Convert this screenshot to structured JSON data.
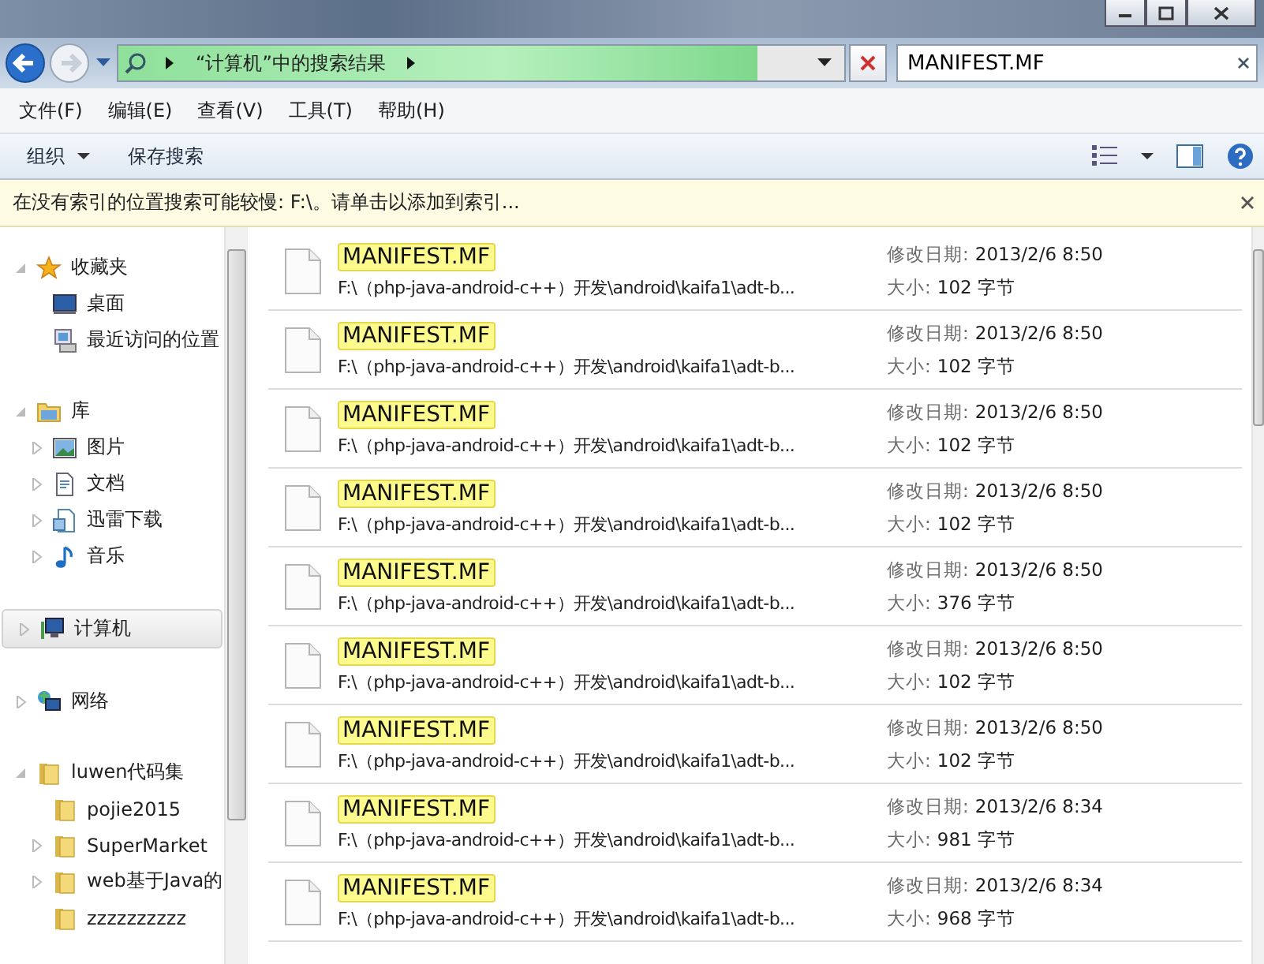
{
  "address": {
    "crumbs": [
      "“计算机”中的搜索结果"
    ]
  },
  "search": {
    "value": "MANIFEST.MF"
  },
  "menu": [
    "文件(F)",
    "编辑(E)",
    "查看(V)",
    "工具(T)",
    "帮助(H)"
  ],
  "toolbar": {
    "organize": "组织",
    "save": "保存搜索"
  },
  "info_bar": "在没有索引的位置搜索可能较慢: F:\\。请单击以添加到索引...",
  "sidebar": [
    {
      "label": "收藏夹",
      "kind": "star",
      "expanded": true,
      "selected": false,
      "children": [
        {
          "label": "桌面",
          "kind": "desktop"
        },
        {
          "label": "最近访问的位置",
          "kind": "recent"
        }
      ]
    },
    {
      "label": "库",
      "kind": "library",
      "expanded": true,
      "selected": false,
      "children": [
        {
          "label": "图片",
          "kind": "pictures",
          "expandable": true
        },
        {
          "label": "文档",
          "kind": "document",
          "expandable": true
        },
        {
          "label": "迅雷下载",
          "kind": "download",
          "expandable": true
        },
        {
          "label": "音乐",
          "kind": "music",
          "expandable": true
        }
      ]
    },
    {
      "label": "计算机",
      "kind": "computer",
      "expanded": false,
      "selected": true
    },
    {
      "label": "网络",
      "kind": "network",
      "expanded": false,
      "selected": false
    },
    {
      "label": "luwen代码集",
      "kind": "folder",
      "expanded": true,
      "selected": false,
      "children": [
        {
          "label": "pojie2015",
          "kind": "folder",
          "expandable": false
        },
        {
          "label": "SuperMarket",
          "kind": "folder",
          "expandable": true
        },
        {
          "label": "web基于Java的",
          "kind": "folder",
          "expandable": true
        },
        {
          "label": "zzzzzzzzzz",
          "kind": "folder",
          "expandable": false
        }
      ]
    }
  ],
  "results": [
    {
      "name": "MANIFEST.MF",
      "path": "F:\\（php-java-android-c++）开发\\android\\kaifa1\\adt-b...",
      "date_label": "修改日期:",
      "date": "2013/2/6 8:50",
      "size_label": "大小:",
      "size": "102 字节"
    },
    {
      "name": "MANIFEST.MF",
      "path": "F:\\（php-java-android-c++）开发\\android\\kaifa1\\adt-b...",
      "date_label": "修改日期:",
      "date": "2013/2/6 8:50",
      "size_label": "大小:",
      "size": "102 字节"
    },
    {
      "name": "MANIFEST.MF",
      "path": "F:\\（php-java-android-c++）开发\\android\\kaifa1\\adt-b...",
      "date_label": "修改日期:",
      "date": "2013/2/6 8:50",
      "size_label": "大小:",
      "size": "102 字节"
    },
    {
      "name": "MANIFEST.MF",
      "path": "F:\\（php-java-android-c++）开发\\android\\kaifa1\\adt-b...",
      "date_label": "修改日期:",
      "date": "2013/2/6 8:50",
      "size_label": "大小:",
      "size": "102 字节"
    },
    {
      "name": "MANIFEST.MF",
      "path": "F:\\（php-java-android-c++）开发\\android\\kaifa1\\adt-b...",
      "date_label": "修改日期:",
      "date": "2013/2/6 8:50",
      "size_label": "大小:",
      "size": "376 字节"
    },
    {
      "name": "MANIFEST.MF",
      "path": "F:\\（php-java-android-c++）开发\\android\\kaifa1\\adt-b...",
      "date_label": "修改日期:",
      "date": "2013/2/6 8:50",
      "size_label": "大小:",
      "size": "102 字节"
    },
    {
      "name": "MANIFEST.MF",
      "path": "F:\\（php-java-android-c++）开发\\android\\kaifa1\\adt-b...",
      "date_label": "修改日期:",
      "date": "2013/2/6 8:50",
      "size_label": "大小:",
      "size": "102 字节"
    },
    {
      "name": "MANIFEST.MF",
      "path": "F:\\（php-java-android-c++）开发\\android\\kaifa1\\adt-b...",
      "date_label": "修改日期:",
      "date": "2013/2/6 8:34",
      "size_label": "大小:",
      "size": "981 字节"
    },
    {
      "name": "MANIFEST.MF",
      "path": "F:\\（php-java-android-c++）开发\\android\\kaifa1\\adt-b...",
      "date_label": "修改日期:",
      "date": "2013/2/6 8:34",
      "size_label": "大小:",
      "size": "968 字节"
    }
  ]
}
